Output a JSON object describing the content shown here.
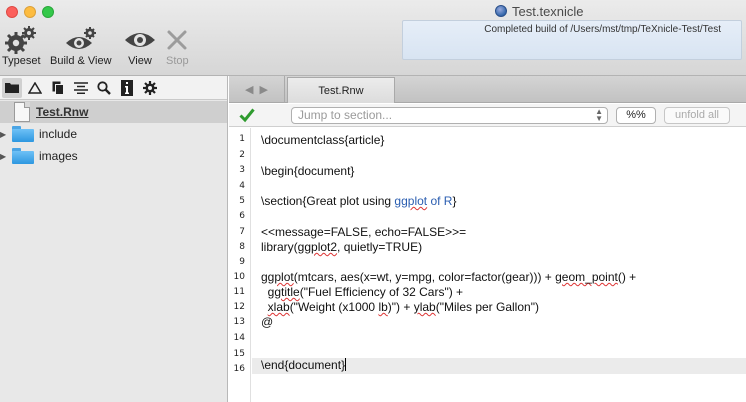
{
  "window": {
    "title": "Test.texnicle",
    "status": "Completed build of /Users/mst/tmp/TeXnicle-Test/Test"
  },
  "toolbar": {
    "typeset": "Typeset",
    "build_view": "Build & View",
    "view": "View",
    "stop": "Stop"
  },
  "sidebar": {
    "items": [
      {
        "label": "Test.Rnw"
      },
      {
        "label": "include"
      },
      {
        "label": "images"
      }
    ]
  },
  "editor": {
    "tab": "Test.Rnw",
    "jump_placeholder": "Jump to section...",
    "percent_btn": "%%",
    "unfold_btn": "unfold all",
    "line_numbers": [
      "1",
      "2",
      "3",
      "4",
      "5",
      "6",
      "7",
      "8",
      "9",
      "10",
      "11",
      "12",
      "13",
      "14",
      "15",
      "16"
    ],
    "lines": {
      "l1": "\\documentclass{article}",
      "l3": "\\begin{document}",
      "l5a": "\\section{Great plot using ",
      "l5b": "ggplot",
      "l5c": " of R",
      "l5d": "}",
      "l7": "<<message=FALSE, echo=FALSE>>=",
      "l8a": "library(",
      "l8b": "ggplot2",
      "l8c": ", quietly=TRUE)",
      "l10a": "ggplot",
      "l10b": "(mtcars, aes(x=wt, y=mpg, color=factor(gear))) + ",
      "l10c": "geom_point",
      "l10d": "() +",
      "l11a": "  ",
      "l11b": "ggtitle",
      "l11c": "(\"Fuel Efficiency of 32 Cars\") +",
      "l12a": "  ",
      "l12b": "xlab",
      "l12c": "(\"Weight (x1000 ",
      "l12d": "lb",
      "l12e": ")\") + ",
      "l12f": "ylab",
      "l12g": "(\"Miles per Gallon\")",
      "l13": "@",
      "l16": "\\end{document}"
    }
  }
}
